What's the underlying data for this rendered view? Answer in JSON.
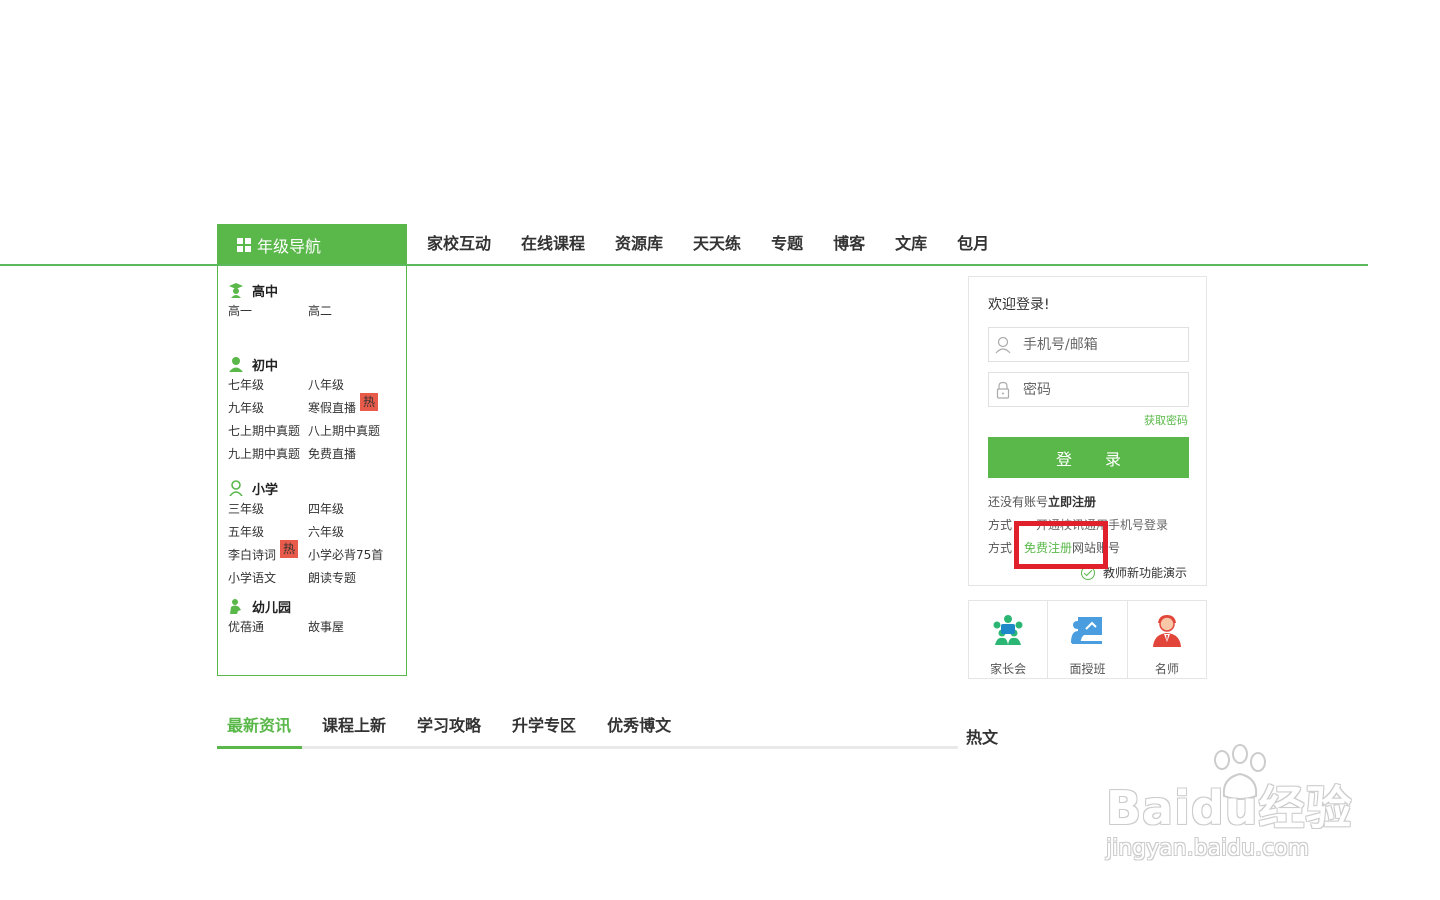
{
  "nav": {
    "grade_nav": "年级导航",
    "items": [
      "家校互动",
      "在线课程",
      "资源库",
      "天天练",
      "专题",
      "博客",
      "文库",
      "包月"
    ]
  },
  "grades": {
    "high": {
      "title": "高中",
      "links": [
        "高一",
        "高二"
      ]
    },
    "middle": {
      "title": "初中",
      "links": [
        "七年级",
        "八年级",
        "九年级",
        "寒假直播",
        "七上期中真题",
        "八上期中真题",
        "九上期中真题",
        "免费直播"
      ]
    },
    "primary": {
      "title": "小学",
      "links": [
        "三年级",
        "四年级",
        "五年级",
        "六年级",
        "李白诗词",
        "小学必背75首",
        "小学语文",
        "朗读专题"
      ]
    },
    "kinder": {
      "title": "幼儿园",
      "links": [
        "优蓓通",
        "故事屋"
      ]
    },
    "hot_badge": "热"
  },
  "login": {
    "welcome": "欢迎登录!",
    "username_placeholder": "手机号/邮箱",
    "password_placeholder": "密码",
    "get_password": "获取密码",
    "login_button": "登 录",
    "no_account": "还没有账号",
    "register_now": "立即注册",
    "method1_prefix": "方式",
    "method1_text": "开通校讯通用手机号登录",
    "method2_prefix": "方式",
    "method2_colon": "：",
    "free_register": "免费注册",
    "method2_suffix": "网站账号",
    "demo": "教师新功能演示"
  },
  "services": [
    "家长会",
    "面授班",
    "名师"
  ],
  "news_tabs": [
    "最新资讯",
    "课程上新",
    "学习攻略",
    "升学专区",
    "优秀博文"
  ],
  "hot_articles": "热文",
  "watermark": {
    "logo": "Baidu经验",
    "url": "jingyan.baidu.com"
  },
  "colors": {
    "brand_green": "#5ab84a",
    "highlight_red": "#e0202a",
    "hot_red": "#e85b4a"
  }
}
